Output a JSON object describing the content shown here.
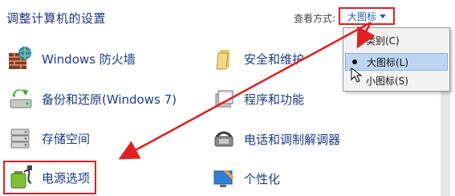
{
  "header": {
    "title": "调整计算机的设置",
    "view_by_label": "查看方式:",
    "view_by_value": "大图标"
  },
  "items_left": [
    {
      "label": "Windows 防火墙",
      "icon": "firewall-icon"
    },
    {
      "label": "备份和还原(Windows 7)",
      "icon": "backup-restore-icon"
    },
    {
      "label": "存储空间",
      "icon": "storage-spaces-icon"
    },
    {
      "label": "电源选项",
      "icon": "power-options-icon"
    }
  ],
  "items_right": [
    {
      "label": "安全和维护",
      "icon": "security-maintenance-icon"
    },
    {
      "label": "程序和功能",
      "icon": "programs-features-icon"
    },
    {
      "label": "电话和调制解调器",
      "icon": "phone-modem-icon"
    },
    {
      "label": "个性化",
      "icon": "personalization-icon"
    }
  ],
  "dropdown": {
    "items": [
      {
        "label": "类别(C)",
        "selected": false
      },
      {
        "label": "大图标(L)",
        "selected": true
      },
      {
        "label": "小图标(S)",
        "selected": false
      }
    ]
  },
  "colors": {
    "annotation_red": "#e02020",
    "link_blue": "#1a3c8c",
    "title_blue": "#1e3287",
    "selected_bg": "#bcd5f0"
  }
}
